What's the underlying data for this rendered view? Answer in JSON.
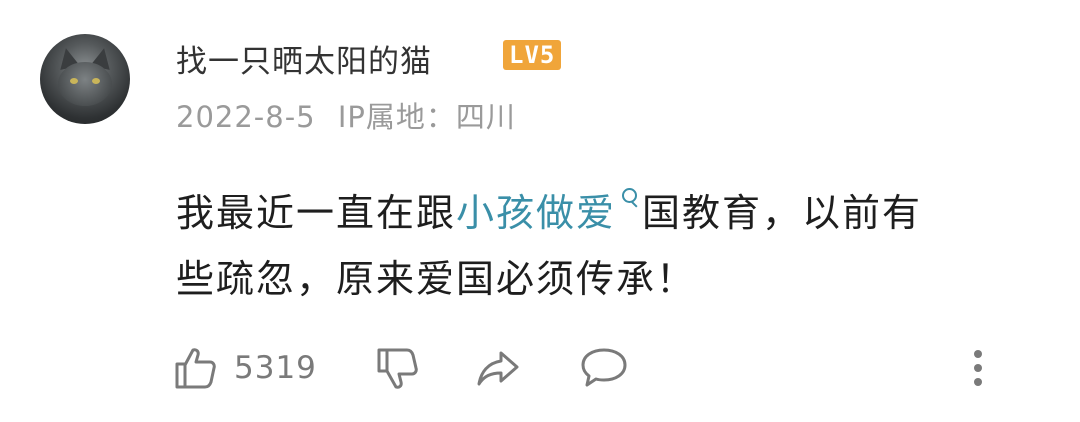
{
  "comment": {
    "username": "找一只晒太阳的猫",
    "level_badge": "LV5",
    "date": "2022-8-5",
    "ip_location": "IP属地：四川",
    "content": {
      "line1_before": "我最近一直在跟",
      "line1_link": "小孩做爱",
      "line1_after": "国教育，以前有",
      "line2": "些疏忽，原来爱国必须传承！"
    },
    "like_count": "5319"
  },
  "icons": {
    "like": "thumbs-up-icon",
    "dislike": "thumbs-down-icon",
    "share": "share-arrow-icon",
    "comment": "comment-bubble-icon",
    "more": "more-vertical-icon",
    "search": "search-icon"
  },
  "colors": {
    "link": "#3a8fa8",
    "badge": "#f0a53a"
  }
}
